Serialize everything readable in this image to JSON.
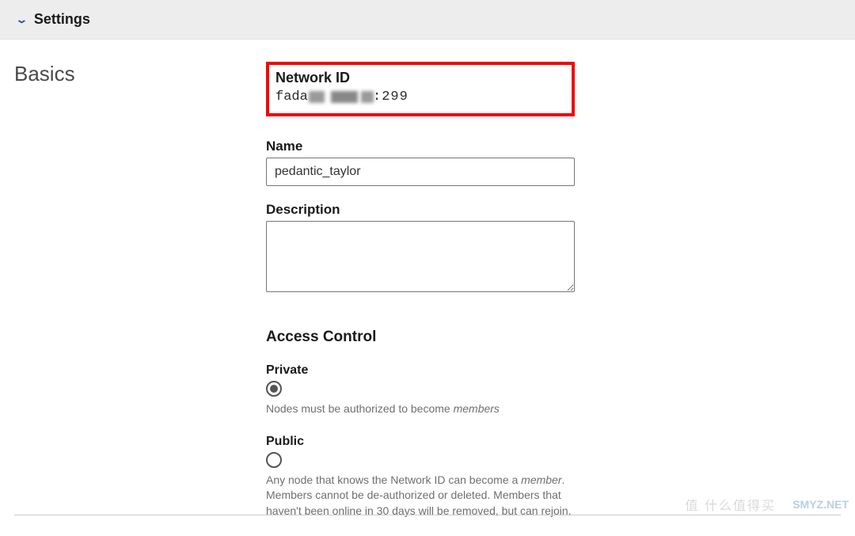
{
  "header": {
    "title": "Settings"
  },
  "section": {
    "label": "Basics"
  },
  "network": {
    "id_label": "Network ID",
    "id_prefix": "fada",
    "id_suffix": ":299",
    "name_label": "Name",
    "name_value": "pedantic_taylor",
    "description_label": "Description",
    "description_value": ""
  },
  "access": {
    "heading": "Access Control",
    "private": {
      "label": "Private",
      "selected": true,
      "helper_prefix": "Nodes must be authorized to become ",
      "helper_em": "members"
    },
    "public": {
      "label": "Public",
      "selected": false,
      "helper_prefix": "Any node that knows the Network ID can become a ",
      "helper_em": "member",
      "helper_suffix": ". Members cannot be de-authorized or deleted. Members that haven't been online in 30 days will be removed, but can rejoin."
    }
  },
  "watermarks": {
    "w1": "值 什么值得买",
    "w2": "SMYZ.NET"
  }
}
